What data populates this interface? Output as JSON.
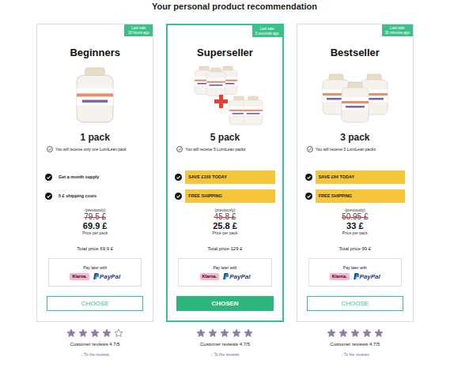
{
  "heading": "Your personal product recommendation",
  "plans": [
    {
      "badge": [
        "Last sale",
        "10 hours ago"
      ],
      "title": "Beginners",
      "kind": "single",
      "pack": "1 pack",
      "note": "You will receive only one LumiLean pack",
      "features": [
        {
          "text": "Get a month supply",
          "highlighted": false
        },
        {
          "text": "5 £ shipping costs",
          "highlighted": false
        }
      ],
      "previously": "(previously)",
      "old_price": "79.5 £",
      "price": "69.9 £",
      "price_label": "Price per pack",
      "total": "Total price 69.9 £",
      "pay_later": "Pay later with",
      "klarna": "Klarna.",
      "paypal": "PayPal",
      "button": "CHOOSE",
      "selected": false,
      "stars": 4,
      "reviews": "Customer reviews 4.7/5",
      "reviews_link": "↓ To the reviews"
    },
    {
      "badge": [
        "Last sale",
        "5 seconds ago"
      ],
      "title": "Superseller",
      "kind": "bundle",
      "pack": "5 pack",
      "note": "You will receive 5 LumiLean packs",
      "features": [
        {
          "text": "SAVE £100 TODAY",
          "highlighted": true
        },
        {
          "text": "FREE SHIPPING",
          "highlighted": true
        }
      ],
      "previously": "(previously)",
      "old_price": "45.8 £",
      "price": "25.8 £",
      "price_label": "Price per pack",
      "total": "Total price 129 £",
      "pay_later": "Pay later with",
      "klarna": "Klarna.",
      "paypal": "PayPal",
      "button": "CHOSEN",
      "selected": true,
      "stars": 5,
      "reviews": "Customer reviews 4.7/5",
      "reviews_link": "↓ To the reviews"
    },
    {
      "badge": [
        "Last sale",
        "30 minutes ago"
      ],
      "title": "Bestseller",
      "kind": "triple",
      "pack": "3 pack",
      "note": "You will receive 3 LumiLean packs",
      "features": [
        {
          "text": "SAVE £64 TODAY",
          "highlighted": true
        },
        {
          "text": "FREE SHIPPING",
          "highlighted": true
        }
      ],
      "previously": "(previously)",
      "old_price": "50.95 £",
      "price": "33 £",
      "price_label": "Price per pack",
      "total": "Total price 99 £",
      "pay_later": "Pay later with",
      "klarna": "Klarna.",
      "paypal": "PayPal",
      "button": "CHOOSE",
      "selected": false,
      "stars": 5,
      "reviews": "Customer reviews 4.7/5",
      "reviews_link": "↓ To the reviews"
    }
  ]
}
